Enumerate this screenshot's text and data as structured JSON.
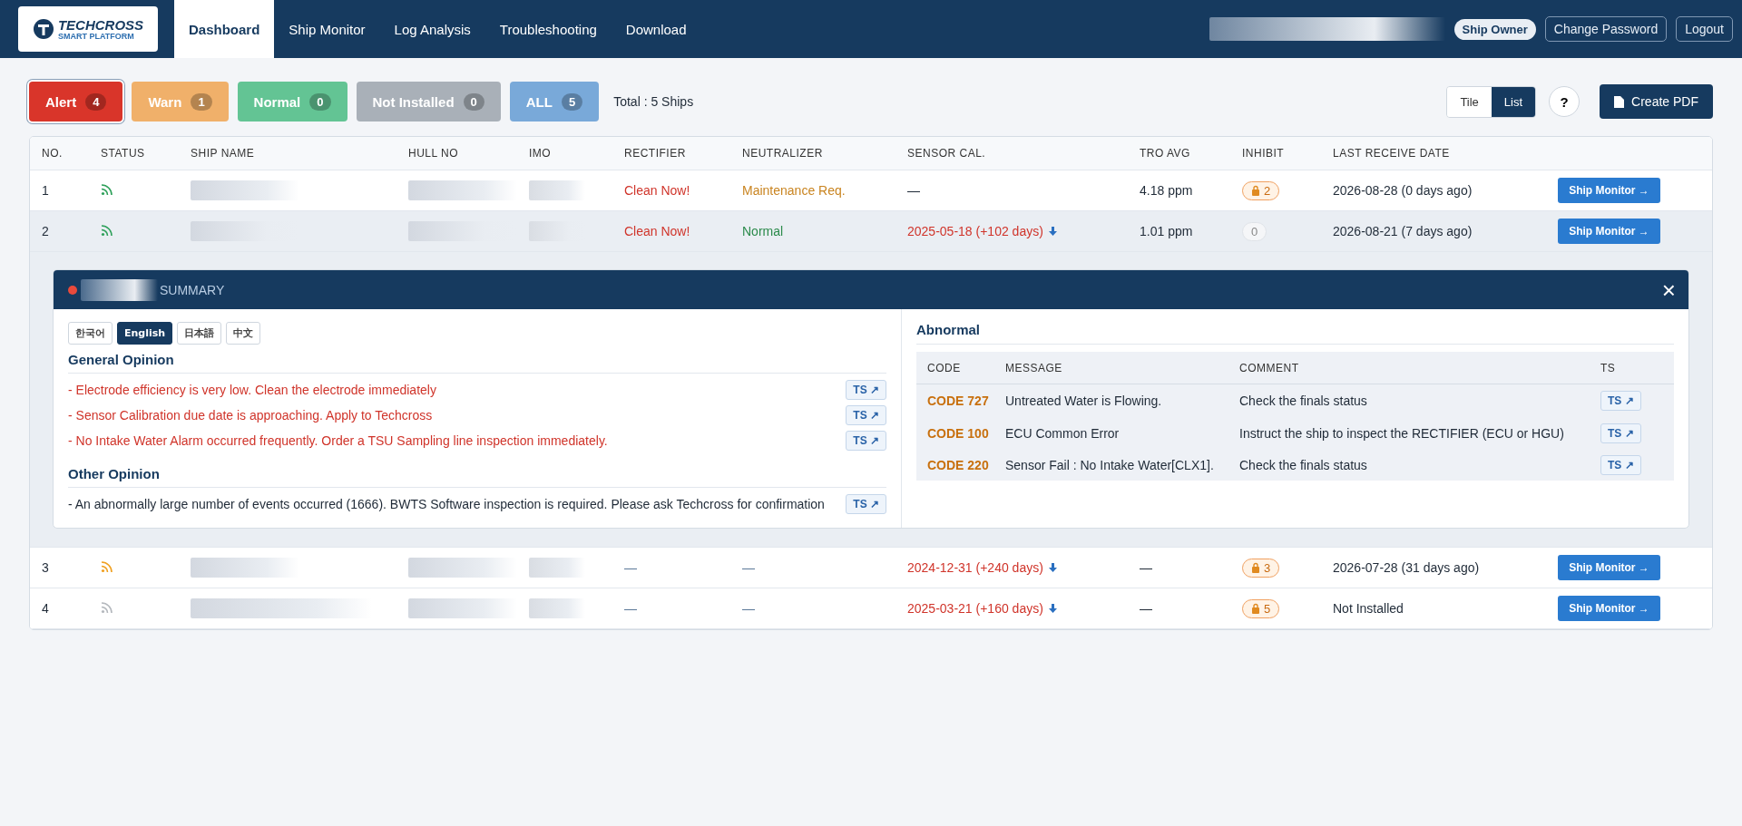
{
  "header": {
    "logo": {
      "name": "TECHCROSS",
      "tagline": "SMART PLATFORM"
    },
    "nav": [
      {
        "label": "Dashboard",
        "selected": true
      },
      {
        "label": "Ship Monitor",
        "selected": false
      },
      {
        "label": "Log Analysis",
        "selected": false
      },
      {
        "label": "Troubleshooting",
        "selected": false
      },
      {
        "label": "Download",
        "selected": false
      }
    ],
    "role": "Ship Owner",
    "actions": [
      "Change Password",
      "Logout"
    ]
  },
  "filters": [
    {
      "label": "Alert",
      "count": "4",
      "color": "#d9352a",
      "selected": true
    },
    {
      "label": "Warn",
      "count": "1",
      "color": "#f0b06a",
      "selected": false
    },
    {
      "label": "Normal",
      "count": "0",
      "color": "#63c494",
      "selected": false
    },
    {
      "label": "Not Installed",
      "count": "0",
      "color": "#a9b0b8",
      "selected": false
    },
    {
      "label": "ALL",
      "count": "5",
      "color": "#79a9d9",
      "selected": false
    }
  ],
  "total": "Total : 5 Ships",
  "view_toggle": [
    {
      "label": "Tile",
      "selected": false
    },
    {
      "label": "List",
      "selected": true
    }
  ],
  "help": "?",
  "create_pdf": "Create PDF",
  "table": {
    "columns": [
      "NO.",
      "STATUS",
      "SHIP NAME",
      "HULL NO",
      "IMO",
      "RECTIFIER",
      "NEUTRALIZER",
      "SENSOR CAL.",
      "TRO AVG",
      "INHIBIT",
      "LAST RECEIVE DATE"
    ],
    "rows": [
      {
        "no": "1",
        "color": "#2ea05a",
        "rectifier": {
          "text": "Clean Now!",
          "color": "#d0342a"
        },
        "neutralizer": {
          "text": "Maintenance Req.",
          "color": "#c98420"
        },
        "sensor_cal": {
          "text": "—",
          "overdue": false
        },
        "tro": "4.18 ppm",
        "inhibit": {
          "count": "2",
          "locked": true
        },
        "last": "2026-08-28 (0 days ago)",
        "button": "Ship Monitor →",
        "expanded": false
      },
      {
        "no": "2",
        "color": "#2ea05a",
        "rectifier": {
          "text": "Clean Now!",
          "color": "#d0342a"
        },
        "neutralizer": {
          "text": "Normal",
          "color": "#2a8a4a"
        },
        "sensor_cal": {
          "text": "2025-05-18 (+102 days)",
          "overdue": true
        },
        "tro": "1.01 ppm",
        "inhibit": {
          "count": "0",
          "locked": false
        },
        "last": "2026-08-21 (7 days ago)",
        "button": "Ship Monitor →",
        "expanded": true,
        "summary": {
          "title": "SUMMARY",
          "close": "×",
          "languages": [
            {
              "label": "한국어",
              "selected": false
            },
            {
              "label": "English",
              "selected": true
            },
            {
              "label": "日本語",
              "selected": false
            },
            {
              "label": "中文",
              "selected": false
            }
          ],
          "sections": [
            {
              "title": "General Opinion",
              "color": "#d0342a",
              "items": [
                {
                  "text": "- Electrode efficiency is very low. Clean the electrode immediately",
                  "ts": "TS ↗"
                },
                {
                  "text": "- Sensor Calibration due date is approaching. Apply to Techcross",
                  "ts": "TS ↗"
                },
                {
                  "text": "- No Intake Water Alarm occurred frequently. Order a TSU Sampling line inspection immediately.",
                  "ts": "TS ↗"
                }
              ]
            },
            {
              "title": "Other Opinion",
              "color": "#1f2a37",
              "items": [
                {
                  "text": "- An abnormally large number of events occurred (1666). BWTS Software inspection is required. Please ask Techcross for confirmation",
                  "ts": "TS ↗"
                }
              ]
            }
          ],
          "abnormal": {
            "title": "Abnormal",
            "columns": [
              "CODE",
              "MESSAGE",
              "COMMENT",
              "TS"
            ],
            "rows": [
              {
                "code": "CODE 727",
                "message": "Untreated Water is Flowing.",
                "comment": "Check the finals status",
                "ts": "TS ↗"
              },
              {
                "code": "CODE 100",
                "message": "ECU Common Error",
                "comment": "Instruct the ship to inspect the RECTIFIER (ECU or HGU)",
                "ts": "TS ↗"
              },
              {
                "code": "CODE 220",
                "message": "Sensor Fail : No Intake Water[CLX1].",
                "comment": "Check the finals status",
                "ts": "TS ↗"
              }
            ]
          }
        }
      },
      {
        "no": "3",
        "color": "#f0a020",
        "rectifier": {
          "text": "—",
          "color": "#5a7898"
        },
        "neutralizer": {
          "text": "—",
          "color": "#5a7898"
        },
        "sensor_cal": {
          "text": "2024-12-31 (+240 days)",
          "overdue": true
        },
        "tro": "—",
        "inhibit": {
          "count": "3",
          "locked": true
        },
        "last": "2026-07-28 (31 days ago)",
        "button": "Ship Monitor →",
        "expanded": false
      },
      {
        "no": "4",
        "color": "#b4b8bd",
        "rectifier": {
          "text": "—",
          "color": "#5a7898"
        },
        "neutralizer": {
          "text": "—",
          "color": "#5a7898"
        },
        "sensor_cal": {
          "text": "2025-03-21 (+160 days)",
          "overdue": true
        },
        "tro": "—",
        "inhibit": {
          "count": "5",
          "locked": true
        },
        "last": "Not Installed",
        "button": "Ship Monitor →",
        "expanded": false
      }
    ]
  }
}
